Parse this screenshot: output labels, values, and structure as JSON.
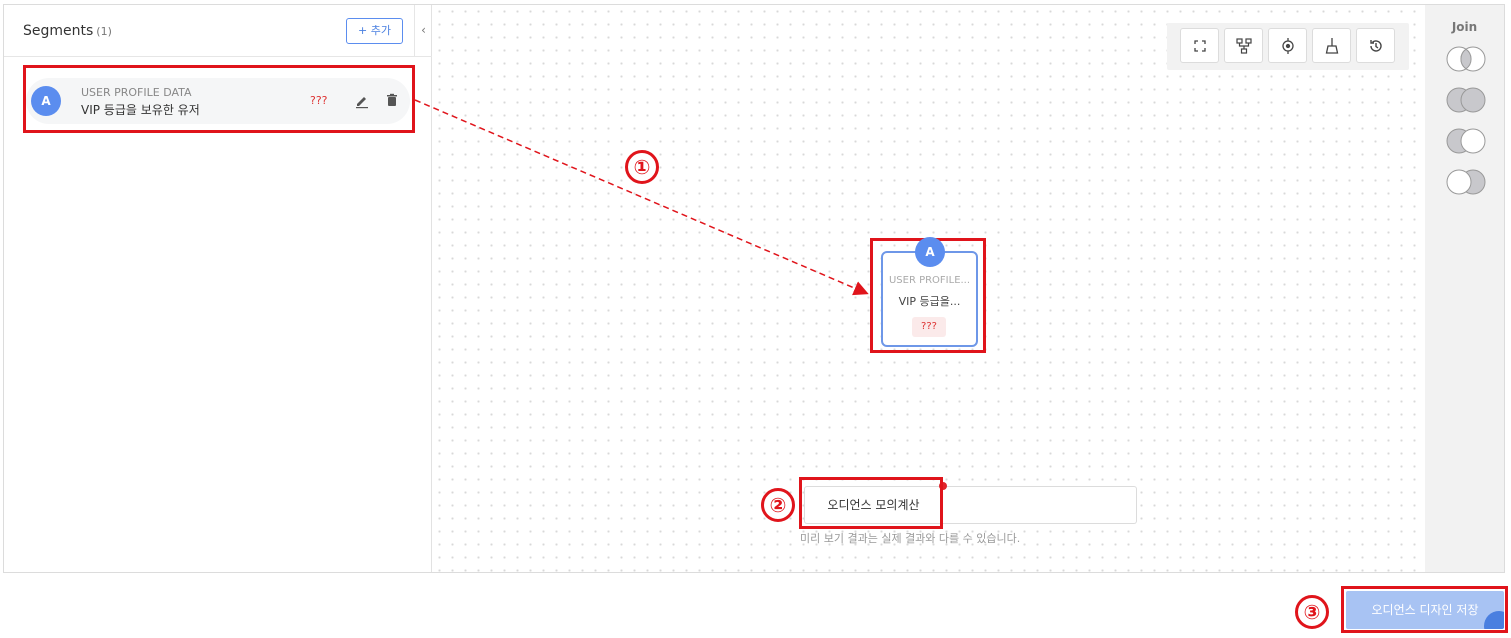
{
  "sidebar": {
    "title": "Segments",
    "count": "(1)",
    "add_button": "+ 추가",
    "collapse_icon": "‹",
    "segments": [
      {
        "avatar": "A",
        "source": "USER PROFILE DATA",
        "name": "VIP 등급을 보유한 유저",
        "count": "???",
        "edit_icon": "pencil-icon",
        "delete_icon": "trash-icon"
      }
    ]
  },
  "toolbar": {
    "buttons": [
      "fullscreen-icon",
      "tree-layout-icon",
      "center-target-icon",
      "cleanup-icon",
      "history-icon"
    ]
  },
  "canvas": {
    "node": {
      "avatar": "A",
      "source": "USER PROFILE...",
      "name": "VIP 등급을...",
      "count": "???"
    },
    "simulation": {
      "button": "오디언스 모의계산",
      "result": "",
      "note": "미리 보기 결과는 실제 결과와 다를 수 있습니다."
    }
  },
  "join_panel": {
    "title": "Join",
    "options": [
      "intersection-icon",
      "union-icon",
      "left-difference-icon",
      "right-difference-icon"
    ]
  },
  "footer": {
    "save_button": "오디언스 디자인 저장"
  },
  "annotations": {
    "callout_1": "①",
    "callout_2": "②",
    "callout_3": "③"
  },
  "colors": {
    "accent": "#5b8def",
    "highlight": "#e0141b",
    "save_button": "#a8c3f3"
  }
}
